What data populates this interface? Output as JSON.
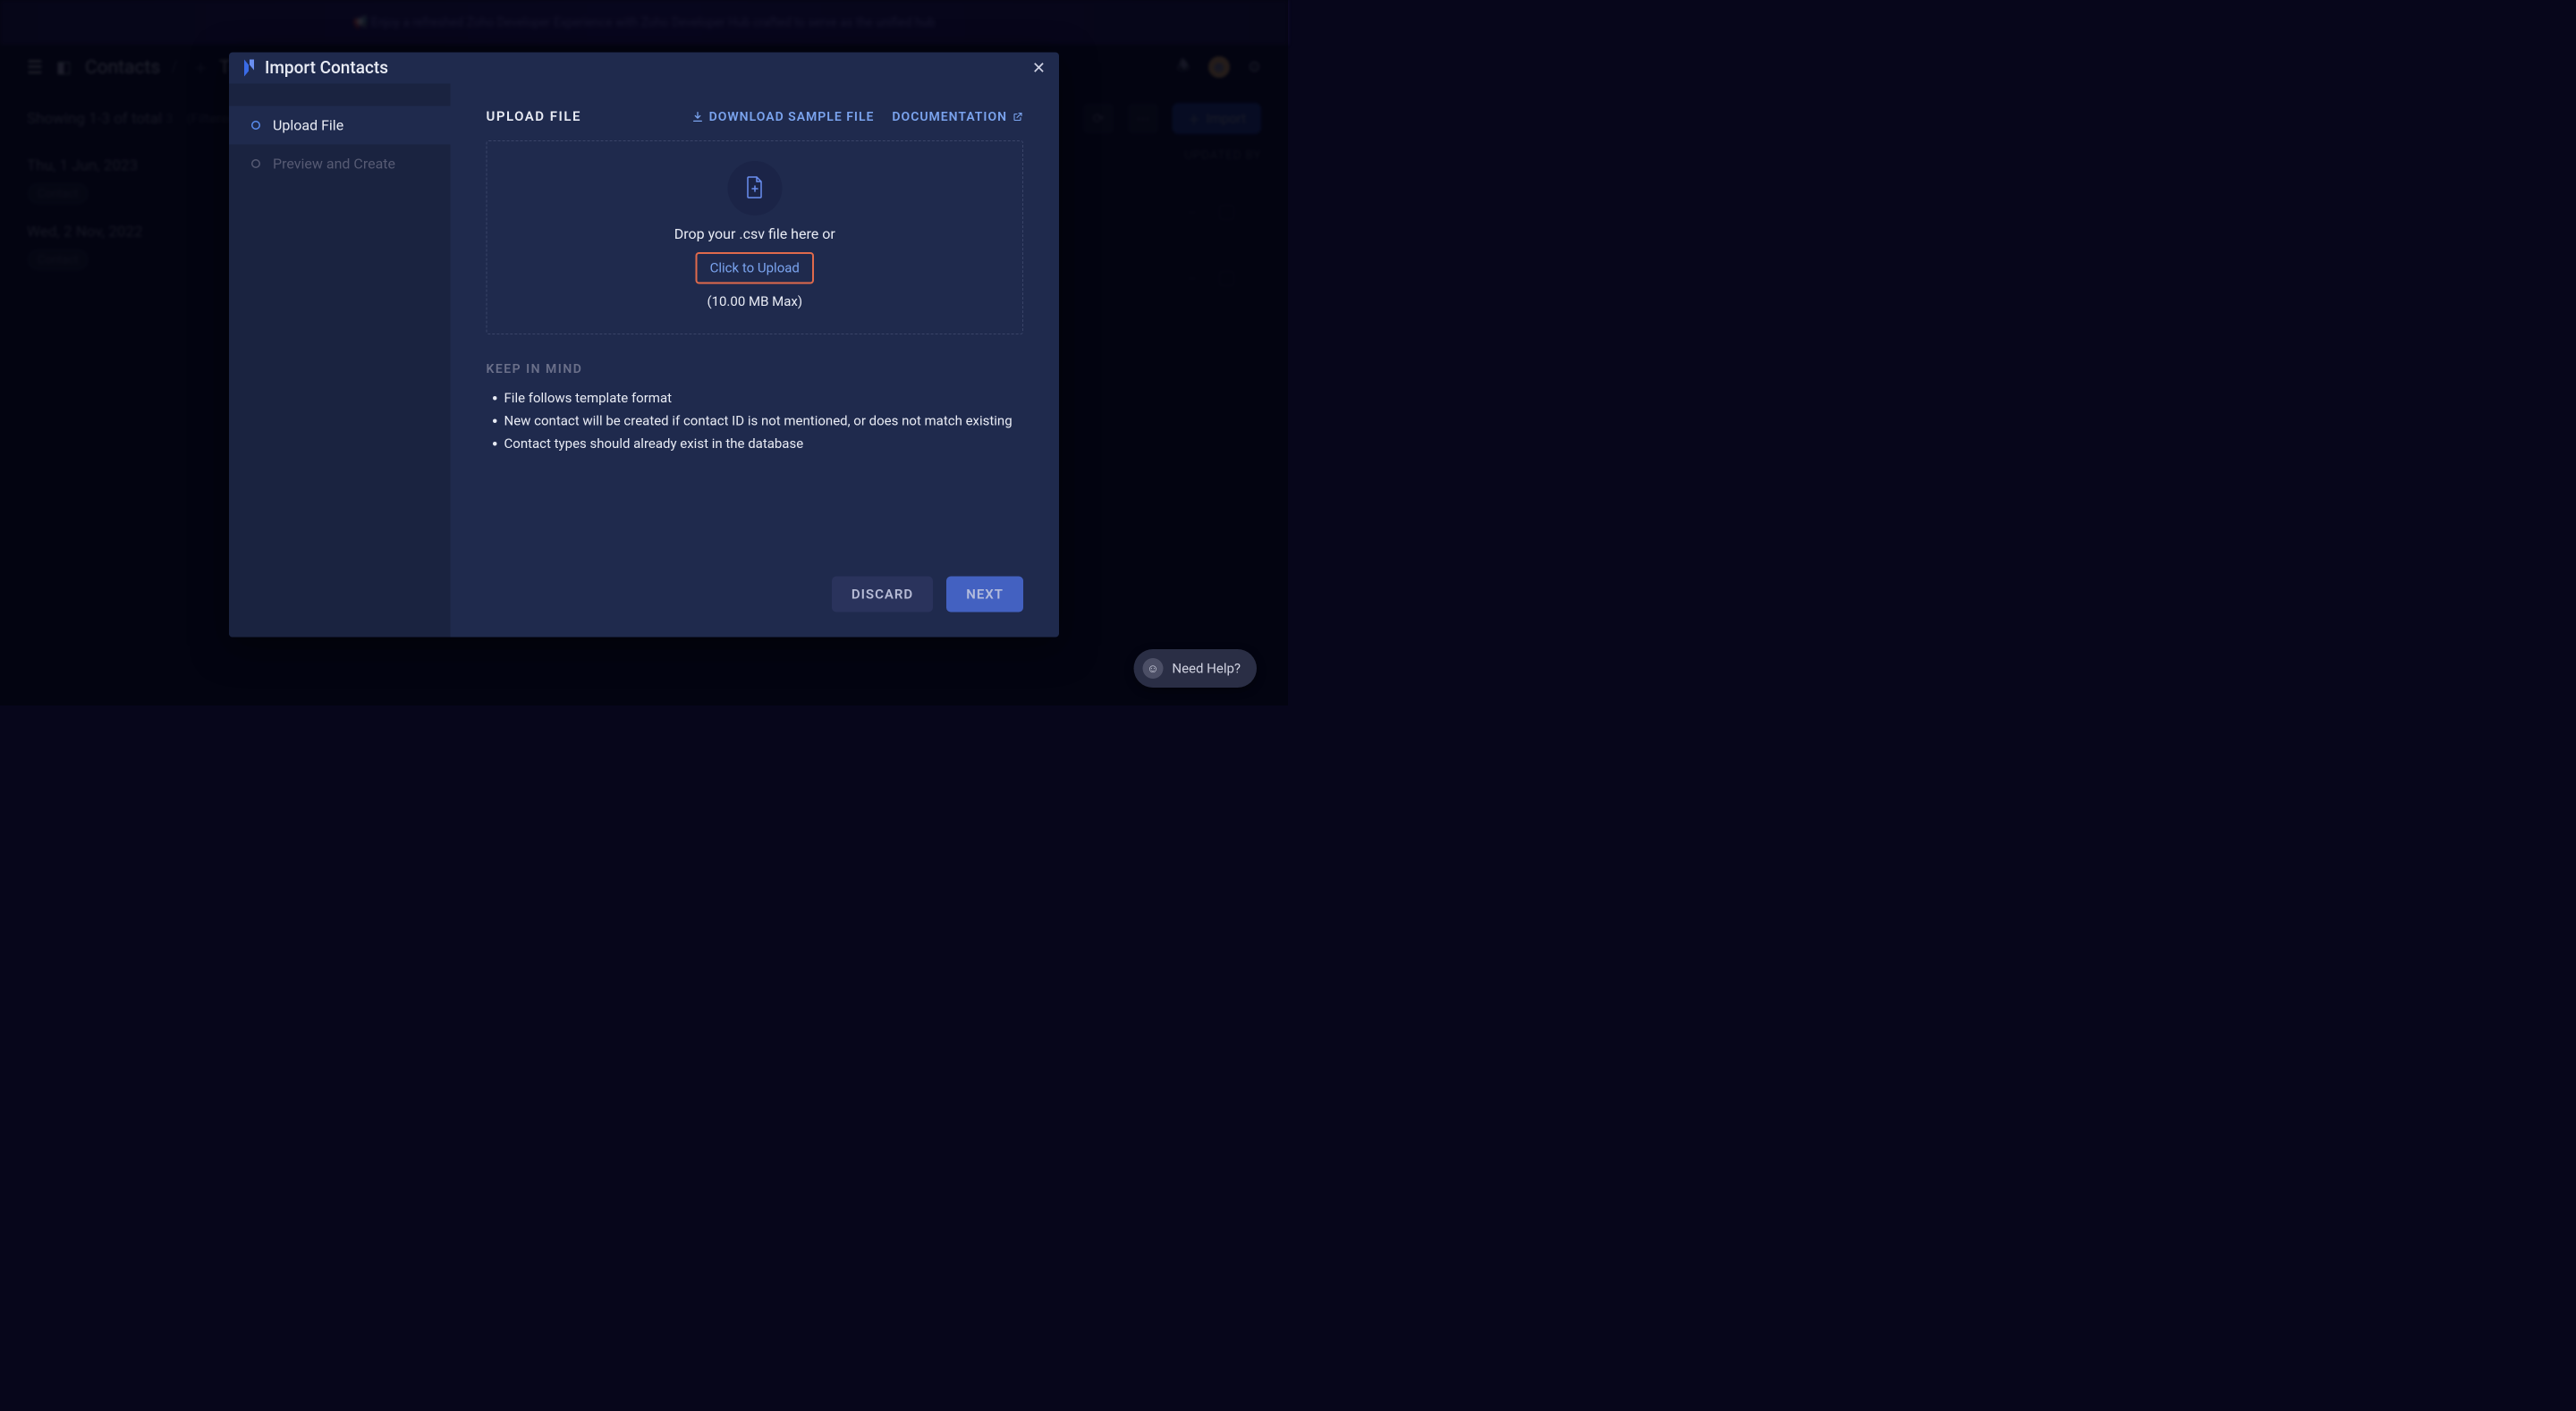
{
  "banner": {
    "text": "📢 Enjoy a refreshed Zoho Developer Experience with Zoho Developer Hub crafted to serve as the unified hub"
  },
  "header": {
    "breadcrumb1": "Contacts",
    "breadcrumb2": "Test Contacts List"
  },
  "subheader": {
    "showing": "Showing 1-3 of total",
    "count": "3",
    "filtered": "(Filtered)",
    "import": "Import"
  },
  "table": {
    "header_updated": "UPDATED BY"
  },
  "list": {
    "groups": [
      {
        "day": "Thu, 1 Jun, 2023",
        "pill": "Contact"
      },
      {
        "day": "Wed, 2 Nov, 2022",
        "pill": "Contact"
      }
    ]
  },
  "modal": {
    "title": "Import Contacts",
    "steps": {
      "upload": "Upload File",
      "preview": "Preview and Create"
    },
    "section_title": "Upload File",
    "download_sample": "Download Sample File",
    "documentation": "Documentation",
    "drop_text": "Drop your .csv file here or",
    "click_upload": "Click to Upload",
    "max_size": "(10.00 MB Max)",
    "keep_in_mind": "Keep in Mind",
    "notes": [
      "File follows template format",
      "New contact will be created if contact ID is not mentioned, or does not match existing",
      "Contact types should already exist in the database"
    ],
    "discard": "Discard",
    "next": "Next"
  },
  "help": {
    "label": "Need Help?"
  }
}
